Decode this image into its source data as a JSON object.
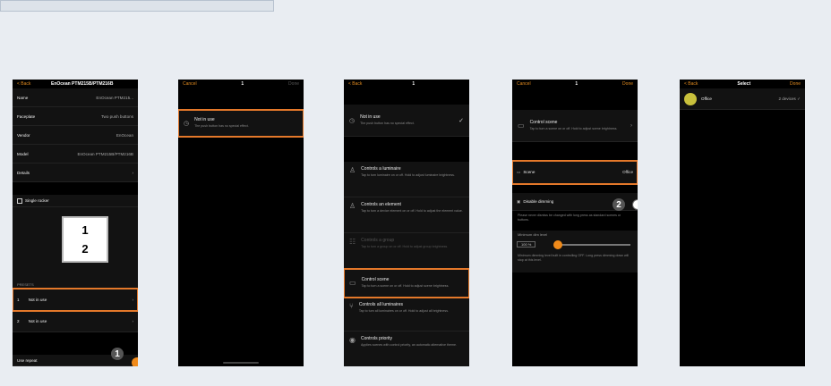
{
  "panel1": {
    "back": "< Back",
    "title": "EnOcean PTM215B/PTM216B",
    "fields": [
      {
        "label": "Name",
        "value": "EnOcean PTM215..."
      },
      {
        "label": "Faceplate",
        "value": "Two push buttons"
      },
      {
        "label": "Vendor",
        "value": "EnOcean"
      },
      {
        "label": "Model",
        "value": "EnOcean PTM215B/PTM216B"
      },
      {
        "label": "Details",
        "value": ""
      }
    ],
    "rocker_label": "Single rocker",
    "faceplate_buttons": [
      "1",
      "2"
    ],
    "presets_header": "PRESETS",
    "presets": [
      {
        "num": "1",
        "label": "Not in use"
      },
      {
        "num": "2",
        "label": "Not in use"
      }
    ],
    "long_press_label": "Use repeat",
    "badge": "1"
  },
  "panel2": {
    "cancel": "Cancel",
    "title": "1",
    "done": "Done",
    "option_title": "Not in use",
    "option_desc": "The push button has no special effect."
  },
  "panel3": {
    "back": "< Back",
    "title": "1",
    "items": [
      {
        "title": "Not in use",
        "desc": "The push button has no special effect."
      },
      {
        "title": "Controls a luminaire",
        "desc": "Tap to turn luminaire on or off. Hold to adjust luminaire brightness."
      },
      {
        "title": "Controls an element",
        "desc": "Tap to turn a device element on or off. Hold to adjust the element value."
      },
      {
        "title": "Controls a group",
        "desc": "Tap to turn a group on or off. Hold to adjust group brightness."
      },
      {
        "title": "Control scene",
        "desc": "Tap to turn a scene on or off. Hold to adjust scene brightness."
      },
      {
        "title": "Controls all luminaires",
        "desc": "Tap to turn all luminaires on or off. Hold to adjust all brightness."
      },
      {
        "title": "Controls priority",
        "desc": "Applies scenes with control priority, an automatic alternative theme."
      }
    ]
  },
  "panel4": {
    "cancel": "Cancel",
    "title": "1",
    "done": "Done",
    "control_title": "Control scene",
    "control_desc": "Tap to turn a scene on or off. Hold to adjust scene brightness.",
    "scene_label": "Scene",
    "scene_value": "Office",
    "disable_label": "Disable dimming",
    "disable_desc": "Please never dismiss be changed with long press as standard scenes or buttons.",
    "min_dim_header": "Minimum dim level",
    "min_dim_value": "100 %",
    "min_dim_desc": "Minimum dimming level built in controlling OFF. Long press dimming down will stop at this level.",
    "badge": "2"
  },
  "panel5": {
    "back": "< Back",
    "title": "Select",
    "done": "Done",
    "room": "Office",
    "room_count": "2 devices"
  },
  "colors": {
    "accent": "#e4782a",
    "orange": "#e08a1f",
    "toggle_on": "#f08a1a"
  }
}
